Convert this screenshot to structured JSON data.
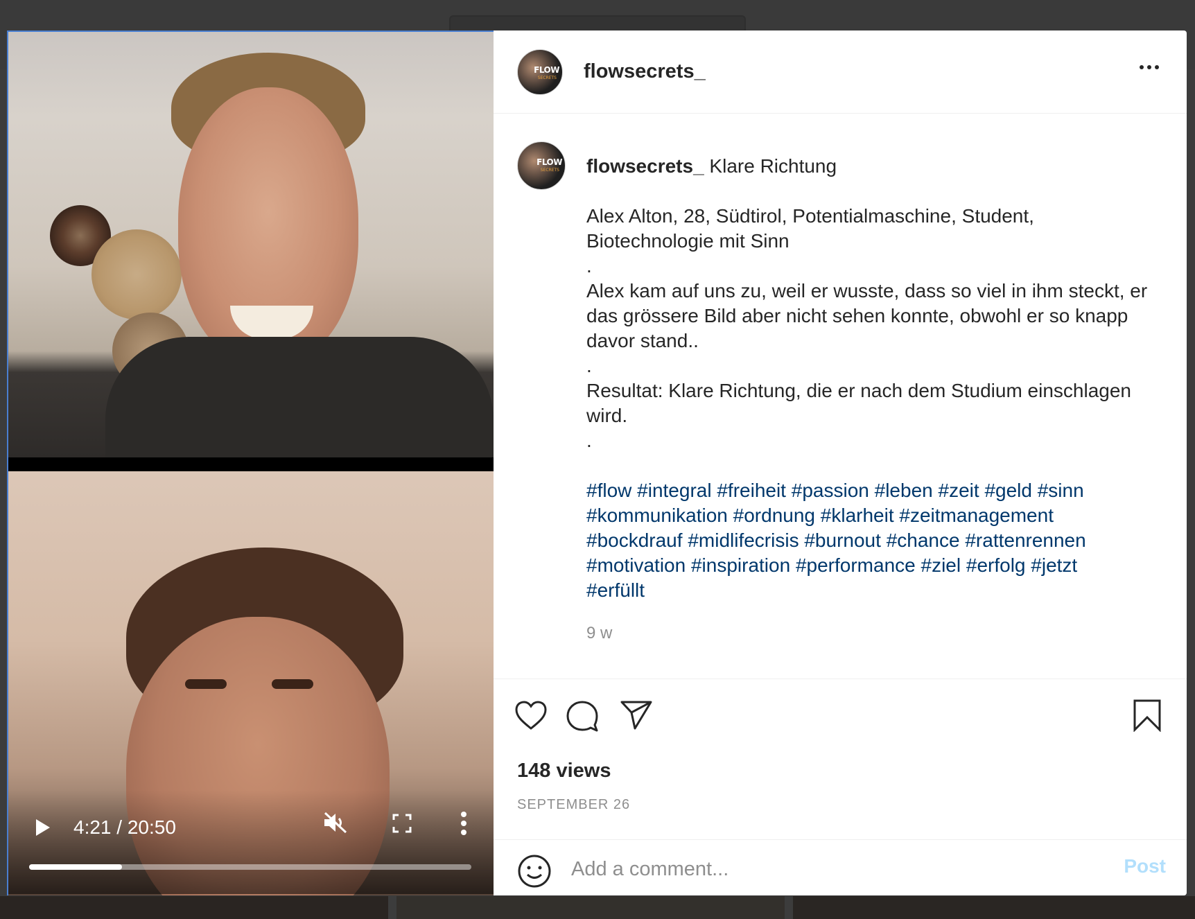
{
  "post": {
    "username": "flowsecrets_",
    "avatar_text": "FLOW",
    "avatar_subtext": "SECRETS",
    "caption_title": "Klare Richtung",
    "caption_lines": [
      "Alex Alton, 28, Südtirol, Potentialmaschine, Student,",
      "Biotechnologie mit Sinn",
      ".",
      "Alex kam auf uns zu, weil er wusste, dass so viel in ihm steckt, er",
      "das grössere Bild aber nicht sehen konnte, obwohl er so knapp",
      "davor stand..",
      ".",
      "Resultat: Klare Richtung, die er nach dem Studium einschlagen",
      "wird.",
      "."
    ],
    "hashtag_lines": [
      "#flow #integral #freiheit #passion #leben #zeit #geld #sinn",
      "#kommunikation #ordnung #klarheit #zeitmanagement",
      "#bockdrauf #midlifecrisis #burnout #chance #rattenrennen",
      "#motivation #inspiration #performance #ziel #erfolg #jetzt",
      "#erfüllt"
    ],
    "time_ago": "9 w",
    "views": "148 views",
    "date": "SEPTEMBER 26"
  },
  "video": {
    "time_display": "4:21 / 20:50",
    "progress_fraction": 0.21,
    "muted": true
  },
  "comment": {
    "placeholder": "Add a comment...",
    "post_label": "Post"
  },
  "icons": {
    "more": "more-horizontal-icon",
    "like": "heart-icon",
    "comment": "comment-bubble-icon",
    "share": "paper-plane-icon",
    "save": "bookmark-icon",
    "emoji": "smiley-icon",
    "play": "play-icon",
    "mute": "volume-muted-icon",
    "fullscreen": "fullscreen-icon",
    "video_more": "more-vertical-icon"
  },
  "colors": {
    "hashtag": "#00376b",
    "post_disabled": "#b2dffc",
    "text": "#262626",
    "muted_text": "#8e8e8e"
  }
}
